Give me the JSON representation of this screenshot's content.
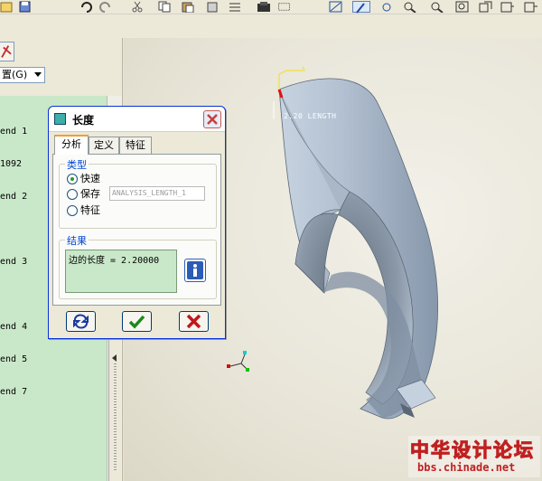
{
  "left_panel": {
    "settings_label": "置(G)",
    "tree_items": [
      "end 1",
      "1092",
      "end 2",
      "end 3",
      "end 4",
      "end 5",
      "end 7"
    ]
  },
  "viewport": {
    "length_label": "2.20 LENGTH"
  },
  "dialog": {
    "title": "长度",
    "tabs": [
      "分析",
      "定义",
      "特征"
    ],
    "type_group": {
      "legend": "类型",
      "options": [
        "快速",
        "保存",
        "特征"
      ],
      "selected": "快速",
      "save_name": "ANALYSIS_LENGTH_1"
    },
    "result_group": {
      "legend": "结果",
      "text": "边的长度 = 2.20000"
    }
  },
  "watermark": {
    "text": "中华设计论坛",
    "url": "bbs.chinade.net"
  },
  "colors": {
    "tree_bg": "#c9e8c9",
    "dialog_border": "#0831d9",
    "accent_blue": "#0046d5",
    "ok_green": "#1a8a1a",
    "cancel_red": "#c01818",
    "watermark_red": "#c02020"
  },
  "icons": {
    "toolbar": [
      "open-icon",
      "save-icon",
      "undo-icon",
      "redo-icon",
      "cut-icon",
      "copy-icon",
      "paste-icon",
      "regenerate-icon",
      "view-icon",
      "zoom-in-icon",
      "zoom-out-icon",
      "refit-icon",
      "spin-icon"
    ],
    "dialog": [
      "dialog-icon",
      "close-icon",
      "info-icon",
      "repeat-icon",
      "ok-check-icon",
      "cancel-x-icon"
    ]
  }
}
